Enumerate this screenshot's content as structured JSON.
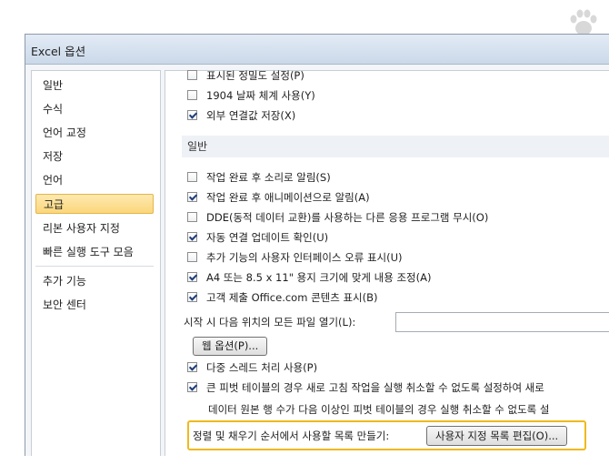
{
  "window": {
    "title": "Excel 옵션"
  },
  "sidebar": {
    "items": [
      {
        "label": "일반"
      },
      {
        "label": "수식"
      },
      {
        "label": "언어 교정"
      },
      {
        "label": "저장"
      },
      {
        "label": "언어"
      },
      {
        "label": "고급",
        "selected": true
      },
      {
        "label": "리본 사용자 지정"
      },
      {
        "label": "빠른 실행 도구 모음"
      },
      {
        "label": "추가 기능"
      },
      {
        "label": "보안 센터"
      }
    ]
  },
  "options_top": [
    {
      "label": "표시된 정밀도 설정(P)",
      "checked": false
    },
    {
      "label": "1904 날짜 체계 사용(Y)",
      "checked": false
    },
    {
      "label": "외부 연결값 저장(X)",
      "checked": true
    }
  ],
  "general_section": {
    "header": "일반",
    "options": [
      {
        "label": "작업 완료 후 소리로 알림(S)",
        "checked": false
      },
      {
        "label": "작업 완료 후 애니메이션으로 알림(A)",
        "checked": true
      },
      {
        "label": "DDE(동적 데이터 교환)를 사용하는 다른 응용 프로그램 무시(O)",
        "checked": false
      },
      {
        "label": "자동 연결 업데이트 확인(U)",
        "checked": true
      },
      {
        "label": "추가 기능의 사용자 인터페이스 오류 표시(U)",
        "checked": false
      },
      {
        "label": "A4 또는 8.5 x 11\" 용지 크기에 맞게 내용 조정(A)",
        "checked": true
      },
      {
        "label": "고객 제출 Office.com 콘텐츠 표시(B)",
        "checked": true
      }
    ],
    "startup_label": "시작 시 다음 위치의 모든 파일 열기(L):",
    "startup_value": "",
    "web_options_button": "웹 옵션(P)...",
    "multithread": {
      "label": "다중 스레드 처리 사용(P)",
      "checked": true
    },
    "pivot_undo": {
      "label": "큰 피벗 테이블의 경우 새로 고침 작업을 실행 취소할 수 없도록 설정하여 새로",
      "checked": true
    },
    "pivot_rows_text": "데이터 원본 행 수가 다음 이상인 피벗 테이블의 경우 실행 취소할 수 없도록 설",
    "custom_list_label": "정렬 및 채우기 순서에서 사용할 목록 만들기:",
    "custom_list_button": "사용자 지정 목록 편집(O)..."
  },
  "colors": {
    "highlight": "#f0b91e",
    "selected_nav": "#fbd77b"
  }
}
